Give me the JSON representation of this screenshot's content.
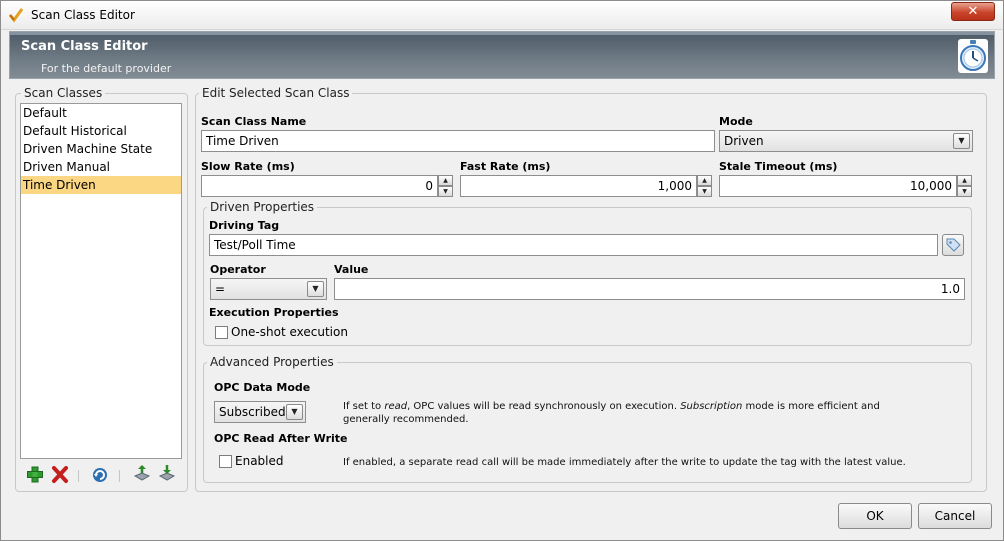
{
  "window": {
    "title": "Scan Class Editor",
    "close_label": "✕"
  },
  "header": {
    "title": "Scan Class Editor",
    "subtitle": "For the default provider",
    "icon": "stopwatch-icon"
  },
  "scan_classes": {
    "legend": "Scan Classes",
    "items": [
      "Default",
      "Default Historical",
      "Driven Machine State",
      "Driven Manual",
      "Time Driven"
    ],
    "selected": "Time Driven",
    "toolbar": [
      "add-icon",
      "delete-icon",
      "refresh-icon",
      "export-icon",
      "import-icon"
    ]
  },
  "edit": {
    "legend": "Edit Selected Scan Class",
    "name_label": "Scan Class Name",
    "name_value": "Time Driven",
    "mode_label": "Mode",
    "mode_value": "Driven",
    "slow_label": "Slow Rate (ms)",
    "slow_value": "0",
    "fast_label": "Fast Rate (ms)",
    "fast_value": "1,000",
    "stale_label": "Stale Timeout (ms)",
    "stale_value": "10,000"
  },
  "driven": {
    "legend": "Driven Properties",
    "driving_tag_label": "Driving Tag",
    "driving_tag_value": "Test/Poll Time",
    "operator_label": "Operator",
    "operator_value": "=",
    "value_label": "Value",
    "value_value": "1.0",
    "exec_label": "Execution Properties",
    "oneshot_label": "One-shot execution",
    "oneshot_checked": false
  },
  "advanced": {
    "legend": "Advanced Properties",
    "opc_mode_label": "OPC Data Mode",
    "opc_mode_value": "Subscribed",
    "opc_help_1": "If set to ",
    "opc_help_read": "read",
    "opc_help_2": ", OPC values will be read synchronously on execution. ",
    "opc_help_sub": "Subscription",
    "opc_help_3": " mode is more efficient and generally recommended.",
    "read_after_label": "OPC Read After Write",
    "enabled_label": "Enabled",
    "enabled_checked": false,
    "enabled_help": "If enabled, a separate read call will be made immediately after the write to update the tag with the latest value."
  },
  "buttons": {
    "ok": "OK",
    "cancel": "Cancel"
  },
  "colors": {
    "selection": "#fbd783",
    "header": "#6f7b85"
  }
}
